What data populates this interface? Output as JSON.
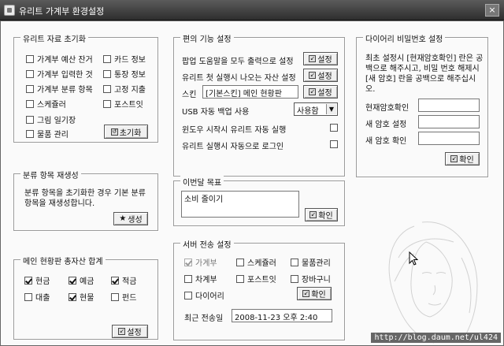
{
  "window": {
    "title": "유리트 가계부 환경설정",
    "close_glyph": "×"
  },
  "reset_group": {
    "legend": "유리트 자료 초기화",
    "items": [
      {
        "label": "가계부 예산 잔거",
        "checked": false
      },
      {
        "label": "카드 정보",
        "checked": false
      },
      {
        "label": "가계부 입력한 것",
        "checked": false
      },
      {
        "label": "통장 정보",
        "checked": false
      },
      {
        "label": "가계부 분류 항목",
        "checked": false
      },
      {
        "label": "고정 지출",
        "checked": false
      },
      {
        "label": "스케쥴러",
        "checked": false
      },
      {
        "label": "포스트잇",
        "checked": false
      },
      {
        "label": "그림 일기장",
        "checked": false
      },
      {
        "label": "물품 관리",
        "checked": false
      }
    ],
    "button": "초기화"
  },
  "category_group": {
    "legend": "분류 항목 재생성",
    "text": "분류 항목을 초기화한 경우 기본 분류 항목을 재생성합니다.",
    "button": "생성"
  },
  "total_group": {
    "legend": "메인 현황판 총자산 합계",
    "items": [
      {
        "label": "현금",
        "checked": true
      },
      {
        "label": "예금",
        "checked": true
      },
      {
        "label": "적금",
        "checked": true
      },
      {
        "label": "대출",
        "checked": false
      },
      {
        "label": "현물",
        "checked": true
      },
      {
        "label": "펀드",
        "checked": false
      }
    ],
    "button": "설정"
  },
  "convenience_group": {
    "legend": "편의 기능 설정",
    "row1": {
      "label": "팝업 도움말을 모두 출력으로 설정",
      "button": "설정"
    },
    "row2": {
      "label": "유리트 첫 실행시 나오는 자산 설정",
      "button": "설정"
    },
    "row3": {
      "label": "스킨",
      "value": "[기본스킨] 메인 현황판",
      "button": "설정"
    },
    "row4": {
      "label": "USB 자동 백업 사용",
      "select": "사용함"
    },
    "row5": {
      "label": "윈도우 시작시 유리트 자동 실행",
      "checked": false
    },
    "row6": {
      "label": "유리트 실행시 자동으로 로그인",
      "checked": false
    }
  },
  "goal_group": {
    "legend": "이번달 목표",
    "text": "소비 줄이기",
    "button": "확인"
  },
  "server_group": {
    "legend": "서버 전송 설정",
    "items": [
      {
        "label": "가계부",
        "checked": true,
        "disabled": true
      },
      {
        "label": "스케쥴러",
        "checked": false
      },
      {
        "label": "물품관리",
        "checked": false
      },
      {
        "label": "차계부",
        "checked": false
      },
      {
        "label": "포스트잇",
        "checked": false
      },
      {
        "label": "장바구니",
        "checked": false
      },
      {
        "label": "다이어리",
        "checked": false
      }
    ],
    "button": "확인",
    "last_label": "최근 전송일",
    "last_value": "2008-11-23 오후 2:40"
  },
  "diary_group": {
    "legend": "다이어리 비밀번호 설정",
    "text": "최초 설정시 [현재암호확인] 란은 공백으로 해주시고, 비밀 번호 해제시 [새 암호] 란을 공백으로 해주십시오.",
    "current_label": "현재암호확인",
    "new_label": "새 암호 설정",
    "confirm_label": "새 암호 확인",
    "button": "확인"
  },
  "watermark": "http://blog.daum.net/ul424"
}
